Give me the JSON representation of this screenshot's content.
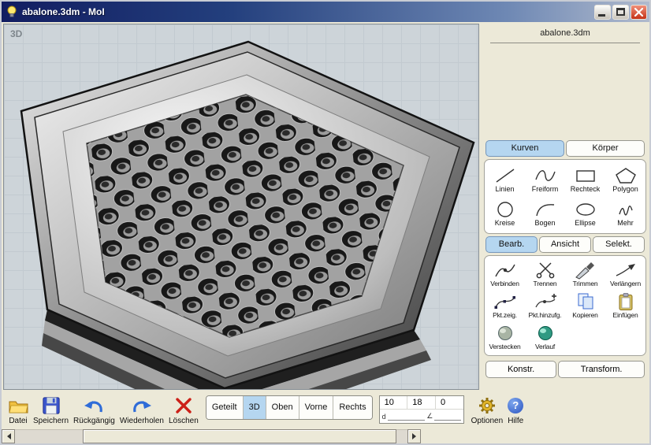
{
  "window": {
    "title": "abalone.3dm - MoI"
  },
  "viewport": {
    "label": "3D"
  },
  "panel": {
    "filename": "abalone.3dm",
    "draw_tabs": [
      {
        "label": "Kurven",
        "active": true
      },
      {
        "label": "Körper",
        "active": false
      }
    ],
    "curve_tools": [
      {
        "label": "Linien",
        "icon": "line-icon"
      },
      {
        "label": "Freiform",
        "icon": "freeform-curve-icon"
      },
      {
        "label": "Rechteck",
        "icon": "rectangle-icon"
      },
      {
        "label": "Polygon",
        "icon": "polygon-icon"
      },
      {
        "label": "Kreise",
        "icon": "circle-icon"
      },
      {
        "label": "Bogen",
        "icon": "arc-icon"
      },
      {
        "label": "Ellipse",
        "icon": "ellipse-icon"
      },
      {
        "label": "Mehr",
        "icon": "more-squiggle-icon"
      }
    ],
    "edit_tabs": [
      {
        "label": "Bearb.",
        "active": true
      },
      {
        "label": "Ansicht",
        "active": false
      },
      {
        "label": "Selekt.",
        "active": false
      }
    ],
    "edit_tools": [
      {
        "label": "Verbinden",
        "icon": "join-icon"
      },
      {
        "label": "Trennen",
        "icon": "scissors-icon"
      },
      {
        "label": "Trimmen",
        "icon": "knife-icon"
      },
      {
        "label": "Verlängern",
        "icon": "extend-arrow-icon"
      },
      {
        "label": "Pkt.zeig.",
        "icon": "show-points-icon"
      },
      {
        "label": "Pkt.hinzufg.",
        "icon": "add-point-icon"
      },
      {
        "label": "Kopieren",
        "icon": "copy-pages-icon"
      },
      {
        "label": "Einfügen",
        "icon": "paste-clipboard-icon"
      },
      {
        "label": "Verstecken",
        "icon": "hide-sphere-icon"
      },
      {
        "label": "Verlauf",
        "icon": "blend-sphere-icon"
      }
    ],
    "panel_buttons": [
      {
        "label": "Konstr."
      },
      {
        "label": "Transform."
      }
    ]
  },
  "toolbar": {
    "file": "Datei",
    "save": "Speichern",
    "undo": "Rückgängig",
    "redo": "Wiederholen",
    "delete": "Löschen",
    "views": [
      {
        "label": "Geteilt",
        "active": false
      },
      {
        "label": "3D",
        "active": true
      },
      {
        "label": "Oben",
        "active": false
      },
      {
        "label": "Vorne",
        "active": false
      },
      {
        "label": "Rechts",
        "active": false
      }
    ],
    "coords": {
      "x": "10",
      "y": "18",
      "z": "0",
      "d_label": "d",
      "angle_label": "∠",
      "d_value": "",
      "angle_value": ""
    },
    "options": "Optionen",
    "help": "Hilfe",
    "help_icon": "?"
  },
  "colors": {
    "active_tab": "#b5d6f0",
    "titlebar_dark": "#121d61",
    "titlebar_light": "#b0bacd",
    "close_button_red": "#c53317",
    "viewport_bg": "#cdd4d9"
  }
}
